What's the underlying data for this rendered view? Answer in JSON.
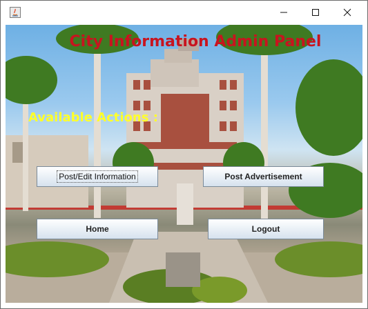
{
  "window": {
    "title": "",
    "controls": {
      "minimize_icon": "minimize-icon",
      "maximize_icon": "maximize-icon",
      "close_icon": "close-icon"
    }
  },
  "panel": {
    "heading": "City Information Admin Panel",
    "subheading": "Available Actions :"
  },
  "actions": {
    "post_edit_label": "Post/Edit Information",
    "post_ad_label": "Post Advertisement",
    "home_label": "Home",
    "logout_label": "Logout"
  },
  "colors": {
    "heading": "#c8141f",
    "subheading": "#ffff2a"
  }
}
